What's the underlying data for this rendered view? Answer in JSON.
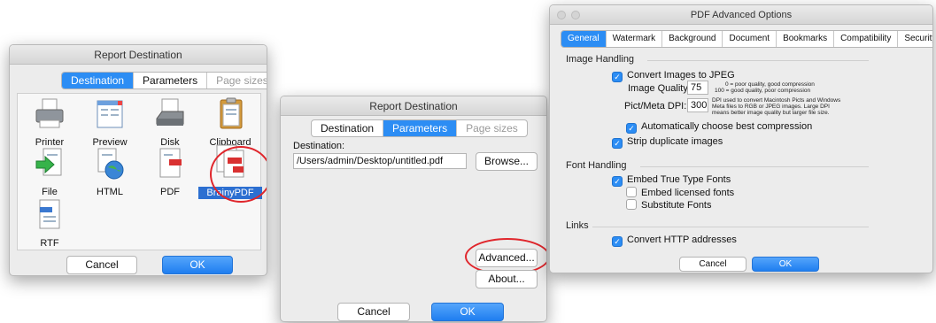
{
  "win1": {
    "title": "Report Destination",
    "tabs": [
      "Destination",
      "Parameters",
      "Page sizes"
    ],
    "icons": [
      {
        "label": "Printer",
        "icon": "printer-icon"
      },
      {
        "label": "Preview",
        "icon": "preview-icon"
      },
      {
        "label": "Disk",
        "icon": "disk-icon"
      },
      {
        "label": "Clipboard",
        "icon": "clipboard-icon"
      },
      {
        "label": "File",
        "icon": "file-icon"
      },
      {
        "label": "HTML",
        "icon": "html-icon"
      },
      {
        "label": "PDF",
        "icon": "pdf-icon"
      },
      {
        "label": "BrainyPDF",
        "icon": "brainypdf-icon"
      },
      {
        "label": "RTF",
        "icon": "rtf-icon"
      }
    ],
    "cancel": "Cancel",
    "ok": "OK"
  },
  "win2": {
    "title": "Report Destination",
    "tabs": [
      "Destination",
      "Parameters",
      "Page sizes"
    ],
    "destination_label": "Destination:",
    "destination_value": "/Users/admin/Desktop/untitled.pdf",
    "browse": "Browse...",
    "advanced": "Advanced...",
    "about": "About...",
    "cancel": "Cancel",
    "ok": "OK"
  },
  "win3": {
    "title": "PDF Advanced Options",
    "tabs": [
      "General",
      "Watermark",
      "Background",
      "Document",
      "Bookmarks",
      "Compatibility",
      "Security"
    ],
    "image_handling": "Image Handling",
    "convert_jpeg": "Convert Images to JPEG",
    "image_quality_label": "Image Quality:",
    "image_quality_value": "75",
    "quality_note_1": "0 = poor quality, good compression",
    "quality_note_2": "100 = good quality, poor compression",
    "dpi_label": "Pict/Meta DPI:",
    "dpi_value": "300",
    "dpi_note_1": "DPI used to convert Macintosh Picts and Windows",
    "dpi_note_2": "Meta files to RGB or JPEG images. Large DPI",
    "dpi_note_3": "means better image quality but larger file size.",
    "auto_compression": "Automatically choose best compression",
    "strip_duplicates": "Strip duplicate images",
    "font_handling": "Font Handling",
    "embed_truetype": "Embed True Type Fonts",
    "embed_licensed": "Embed licensed fonts",
    "substitute_fonts": "Substitute Fonts",
    "links": "Links",
    "convert_http": "Convert HTTP addresses",
    "cancel": "Cancel",
    "ok": "OK"
  },
  "colors": {
    "accent": "#2c8df4",
    "highlight_ring": "#e0262c"
  }
}
